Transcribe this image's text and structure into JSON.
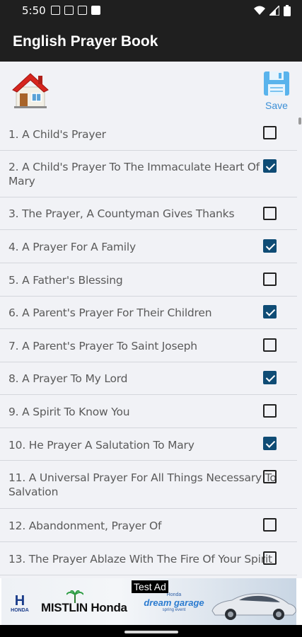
{
  "status_bar": {
    "time": "5:50"
  },
  "app_bar": {
    "title": "English Prayer Book"
  },
  "toolbar": {
    "save_label": "Save"
  },
  "prayers": [
    {
      "label": "1. A Child's Prayer",
      "checked": false
    },
    {
      "label": "2. A Child's Prayer To The Immaculate Heart Of Mary",
      "checked": true
    },
    {
      "label": "3. The Prayer, A Countyman Gives Thanks",
      "checked": false
    },
    {
      "label": "4. A Prayer For A Family",
      "checked": true
    },
    {
      "label": "5. A Father's Blessing",
      "checked": false
    },
    {
      "label": "6. A Parent's Prayer For Their Children",
      "checked": true
    },
    {
      "label": "7. A Parent's Prayer To Saint Joseph",
      "checked": false
    },
    {
      "label": "8. A Prayer To My Lord",
      "checked": true
    },
    {
      "label": "9. A Spirit To Know You",
      "checked": false
    },
    {
      "label": "10. He Prayer A Salutation To Mary",
      "checked": true
    },
    {
      "label": "11. A Universal Prayer For All Things Necessary To Salvation",
      "checked": false
    },
    {
      "label": "12. Abandonment, Prayer Of",
      "checked": false
    },
    {
      "label": "13. The Prayer Ablaze With The Fire Of Your Spirit",
      "checked": false
    }
  ],
  "ad": {
    "tag": "Test Ad",
    "logo_text": "HONDA",
    "brand": "MISTLIN Honda",
    "promo_top": "Honda",
    "promo_title": "dream garage",
    "promo_sub": "spring event"
  },
  "colors": {
    "checkbox_checked": "#0f4c75",
    "save_accent": "#3b8fd6",
    "app_bar": "#1f1f1f"
  }
}
